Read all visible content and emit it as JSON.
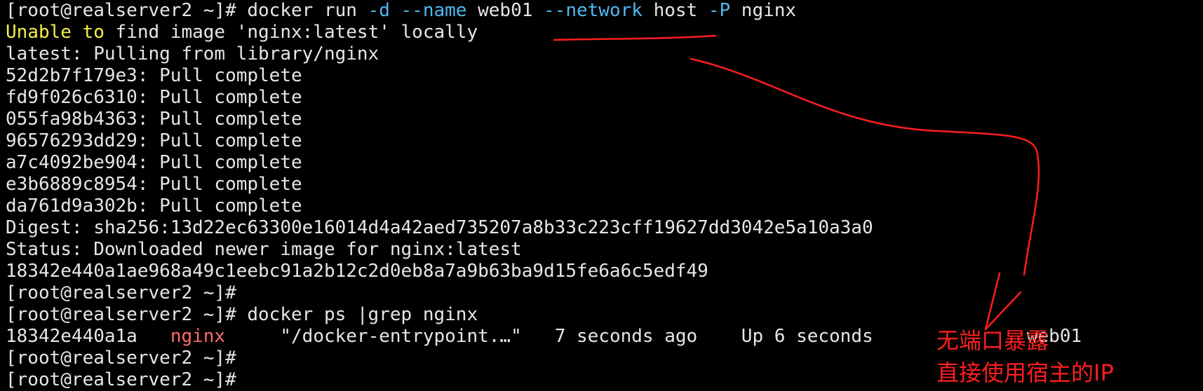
{
  "terminal": {
    "lines": [
      [
        {
          "t": "[root@realserver2 ~]# docker run ",
          "c": "white"
        },
        {
          "t": "-d",
          "c": "opt"
        },
        {
          "t": " ",
          "c": "white"
        },
        {
          "t": "--name",
          "c": "opt"
        },
        {
          "t": " web01 ",
          "c": "white"
        },
        {
          "t": "--network",
          "c": "opt"
        },
        {
          "t": " host ",
          "c": "white"
        },
        {
          "t": "-P",
          "c": "opt"
        },
        {
          "t": " nginx",
          "c": "white"
        }
      ],
      [
        {
          "t": "Unable to",
          "c": "yellow"
        },
        {
          "t": " find image 'nginx:latest' locally",
          "c": "white"
        }
      ],
      [
        {
          "t": "latest: Pulling from library/nginx",
          "c": "white"
        }
      ],
      [
        {
          "t": "52d2b7f179e3: Pull complete",
          "c": "white"
        }
      ],
      [
        {
          "t": "fd9f026c6310: Pull complete",
          "c": "white"
        }
      ],
      [
        {
          "t": "055fa98b4363: Pull complete",
          "c": "white"
        }
      ],
      [
        {
          "t": "96576293dd29: Pull complete",
          "c": "white"
        }
      ],
      [
        {
          "t": "a7c4092be904: Pull complete",
          "c": "white"
        }
      ],
      [
        {
          "t": "e3b6889c8954: Pull complete",
          "c": "white"
        }
      ],
      [
        {
          "t": "da761d9a302b: Pull complete",
          "c": "white"
        }
      ],
      [
        {
          "t": "Digest: sha256:13d22ec63300e16014d4a42aed735207a8b33c223cff19627dd3042e5a10a3a0",
          "c": "white"
        }
      ],
      [
        {
          "t": "Status: Downloaded newer image for nginx:latest",
          "c": "white"
        }
      ],
      [
        {
          "t": "18342e440a1ae968a49c1eebc91a2b12c2d0eb8a7a9b63ba9d15fe6a6c5edf49",
          "c": "white"
        }
      ],
      [
        {
          "t": "[root@realserver2 ~]#",
          "c": "white"
        }
      ],
      [
        {
          "t": "[root@realserver2 ~]# docker ps |grep nginx",
          "c": "white"
        }
      ],
      [
        {
          "t": "18342e440a1a   ",
          "c": "white"
        },
        {
          "t": "nginx",
          "c": "red"
        },
        {
          "t": "     \"/docker-entrypoint.…\"   7 seconds ago    Up 6 seconds              web01",
          "c": "white"
        }
      ],
      [
        {
          "t": "[root@realserver2 ~]#",
          "c": "white"
        }
      ],
      [
        {
          "t": "[root@realserver2 ~]#",
          "c": "white"
        }
      ]
    ]
  },
  "annotation": {
    "line1": "无端口暴露",
    "line2": "直接使用宿主的IP"
  },
  "colors": {
    "background": "#000000",
    "text": "#e6e6e6",
    "option": "#4fb8f0",
    "warning": "#f2ef4a",
    "highlight": "#ff6a6a",
    "annotation": "#ff1e1e"
  }
}
